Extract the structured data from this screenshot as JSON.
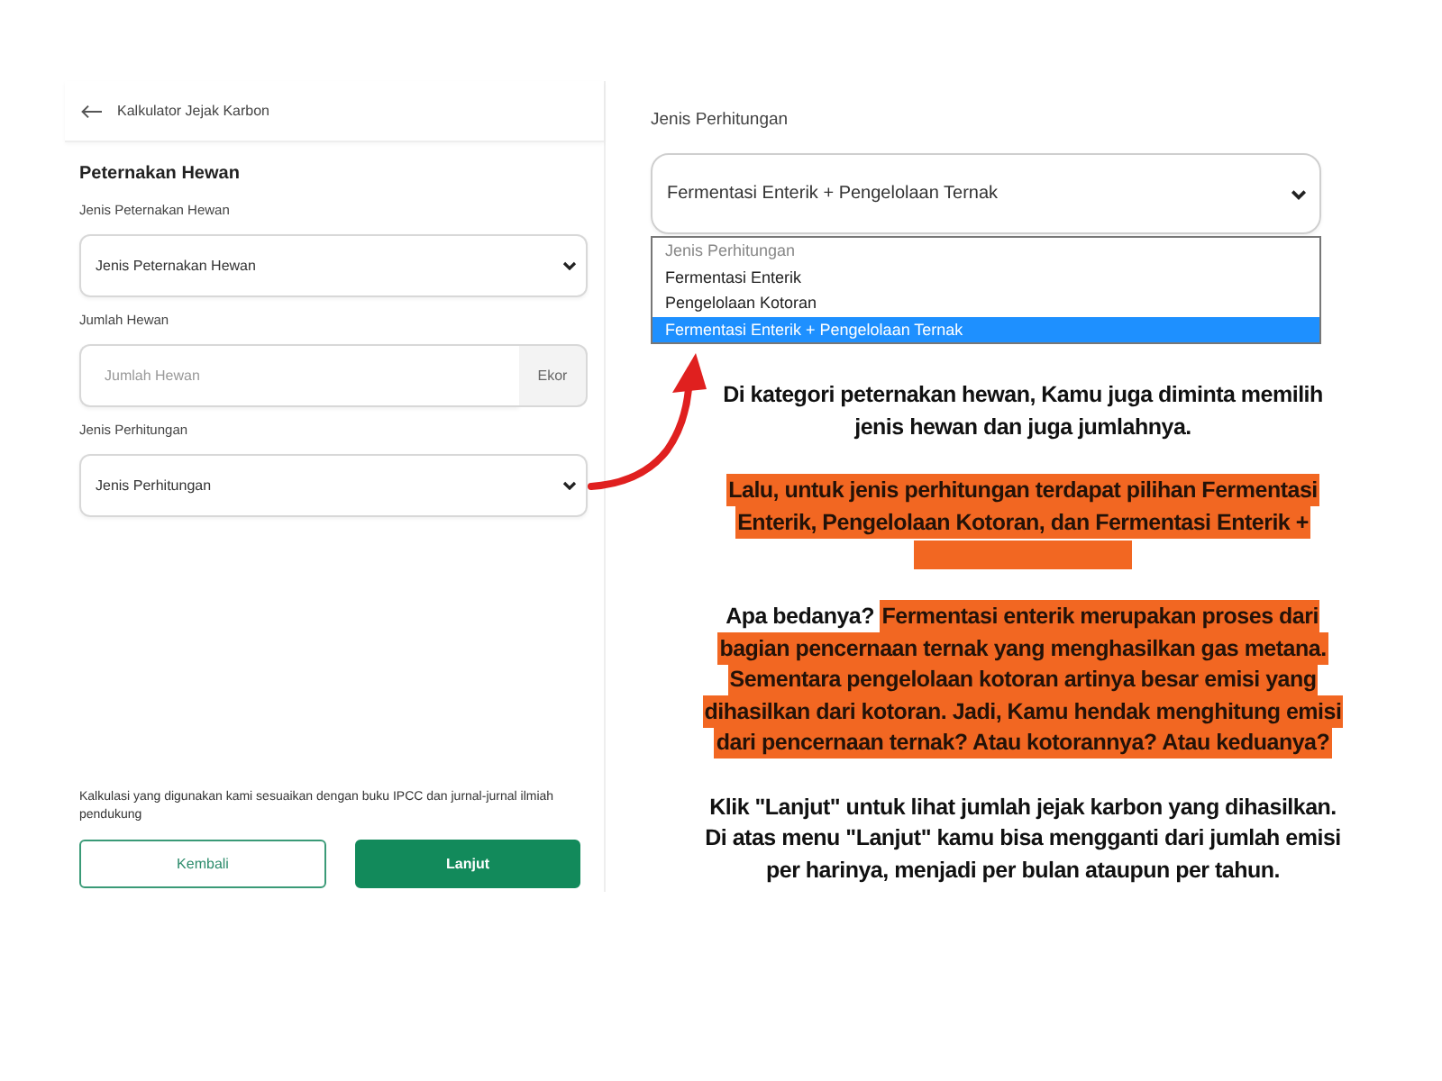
{
  "calculator": {
    "header": {
      "title": "Kalkulator Jejak Karbon"
    },
    "section_title": "Peternakan Hewan",
    "fields": [
      {
        "kind": "select",
        "label": "Jenis Peternakan Hewan",
        "value": "Jenis Peternakan Hewan"
      },
      {
        "kind": "number",
        "label": "Jumlah Hewan",
        "placeholder": "Jumlah Hewan",
        "unit": "Ekor"
      },
      {
        "kind": "select",
        "label": "Jenis Perhitungan",
        "value": "Jenis Perhitungan"
      }
    ],
    "note": "Kalkulasi yang digunakan kami sesuaikan dengan buku IPCC dan jurnal-jurnal ilmiah pendukung",
    "buttons": [
      {
        "kind": "secondary",
        "label": "Kembali"
      },
      {
        "kind": "primary",
        "label": "Lanjut"
      }
    ]
  },
  "zoomed_select": {
    "label": "Jenis Perhitungan",
    "value": "Fermentasi Enterik + Pengelolaan Ternak",
    "expanded": true,
    "options": [
      {
        "label": "Jenis Perhitungan",
        "disabled": true,
        "selected": false
      },
      {
        "label": "Fermentasi Enterik",
        "disabled": false,
        "selected": false
      },
      {
        "label": "Pengelolaan Kotoran",
        "disabled": false,
        "selected": false
      },
      {
        "label": "Fermentasi Enterik + Pengelolaan Ternak",
        "disabled": false,
        "selected": true
      }
    ]
  },
  "explanation": [
    {
      "segments": [
        {
          "text": "Di kategori peternakan hewan, Kamu juga diminta memilih jenis hewan dan juga jumlahnya.",
          "highlighted": false
        }
      ]
    },
    {
      "segments": [
        {
          "text": "Lalu, untuk jenis perhitungan terdapat pilihan Fermentasi Enterik, Pengelolaan Kotoran, dan Fermentasi Enterik +",
          "highlighted": true
        }
      ],
      "trailing_highlight": true
    },
    {
      "segments": [
        {
          "text": "Apa bedanya?",
          "highlighted": false
        },
        {
          "text": "Fermentasi enterik merupakan proses dari bagian pencernaan ternak yang menghasilkan gas metana. Sementara pengelolaan kotoran artinya besar emisi yang dihasilkan dari kotoran. Jadi, Kamu hendak menghitung emisi dari pencernaan ternak? Atau kotorannya? Atau keduanya?",
          "highlighted": true
        }
      ]
    },
    {
      "segments": [
        {
          "text": "Klik \"Lanjut\" untuk lihat jumlah jejak karbon yang dihasilkan. Di atas menu \"Lanjut\" kamu bisa mengganti dari jumlah emisi per harinya, menjadi per bulan ataupun per tahun.",
          "highlighted": false
        }
      ]
    }
  ]
}
